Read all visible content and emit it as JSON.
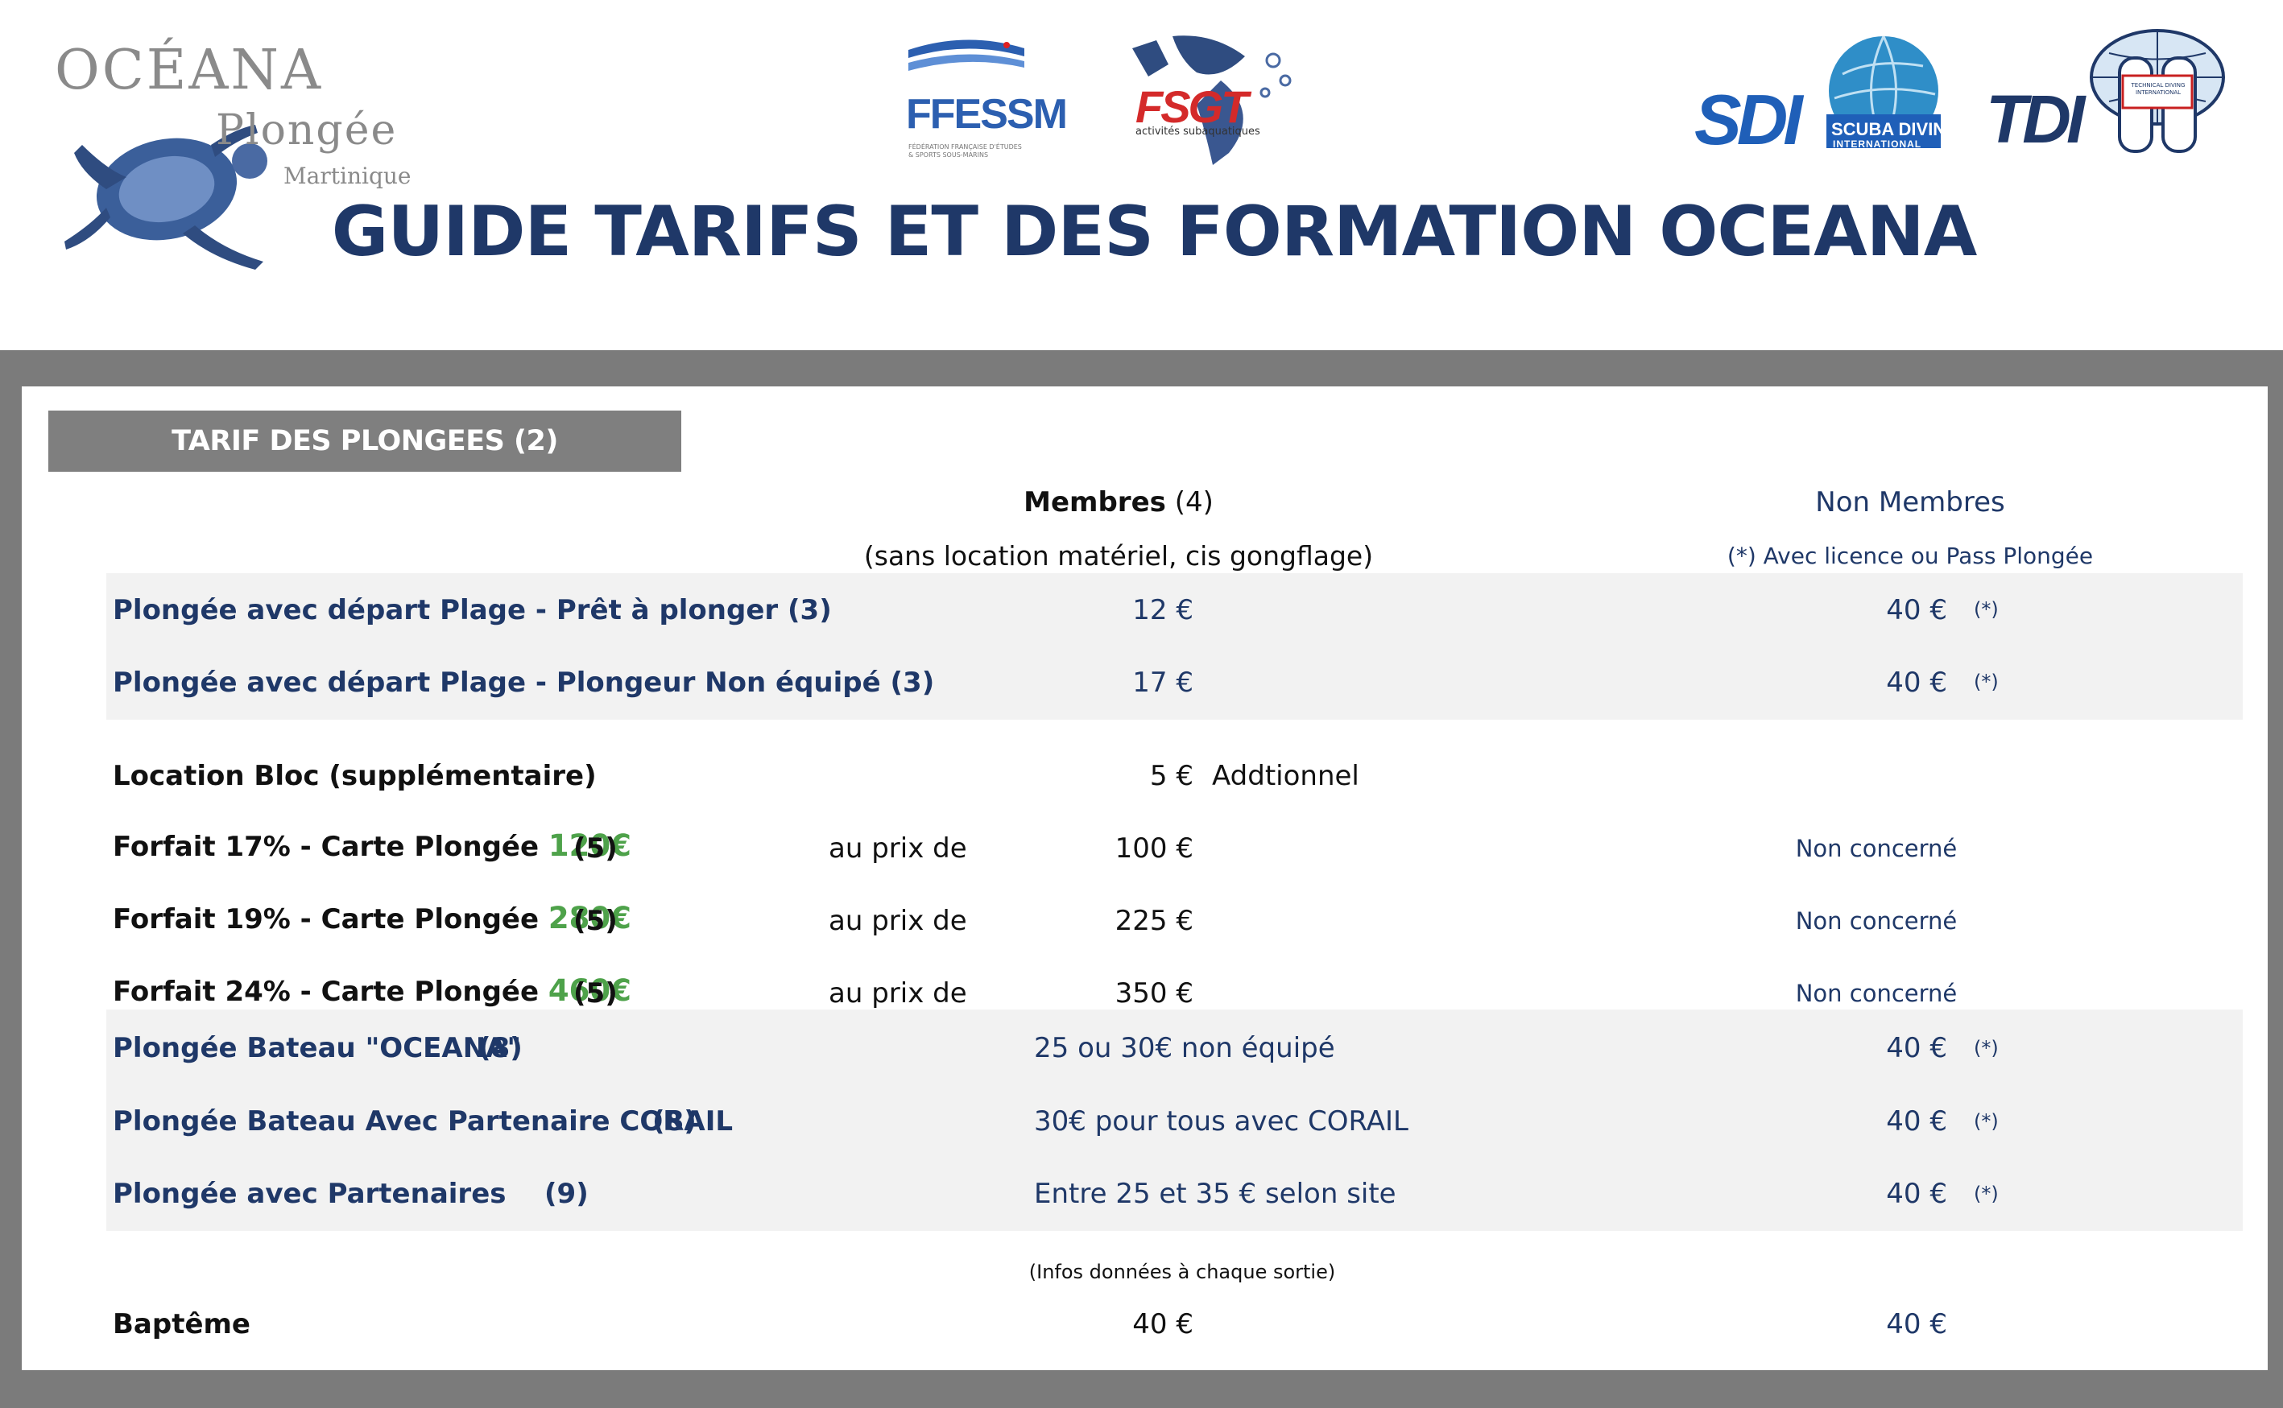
{
  "logos": {
    "oceana_line1": "OCÉANA",
    "oceana_line2": "Plongée",
    "oceana_line3": "Martinique",
    "ffessm": "FFESSM",
    "ffessm_sub": "FÉDÉRATION FRANÇAISE D'ÉTUDES & SPORTS SOUS-MARINS",
    "fsgt": "FSGT",
    "fsgt_sub": "activités subaquatiques",
    "sdi": "SDI",
    "sdi_sub1": "SCUBA DIVING",
    "sdi_sub2": "INTERNATIONAL",
    "tdi": "TDI",
    "tdi_sub": "TECHNICAL DIVING INTERNATIONAL"
  },
  "page_title": "GUIDE TARIFS ET DES FORMATION OCEANA",
  "section_title": "TARIF DES PLONGEES (2)",
  "columns": {
    "members_bold": "Membres",
    "members_note": " (4)",
    "members_sub": "(sans location matériel, cis gongflage)",
    "non_members": "Non Membres",
    "non_members_sub": "(*) Avec licence ou Pass Plongée"
  },
  "rows": {
    "r1": {
      "label": "Plongée avec départ Plage -  Prêt à plonger (3)",
      "member": "12 €",
      "non_member": "40 €",
      "star": "(*)"
    },
    "r2": {
      "label": "Plongée avec départ Plage - Plongeur Non équipé (3)",
      "member": "17 €",
      "non_member": "40 €",
      "star": "(*)"
    },
    "r3": {
      "label": "Location Bloc (supplémentaire)",
      "member": "5 €",
      "extra": "Addtionnel"
    },
    "r4": {
      "label": "Forfait 17% - Carte Plongée ",
      "price": "120€",
      "note": "(5)",
      "au_prix": "au prix de",
      "member": "100 €",
      "non_member": "Non concerné"
    },
    "r5": {
      "label": "Forfait 19% - Carte Plongée ",
      "price": "280€",
      "note": "(5)",
      "au_prix": "au prix de",
      "member": "225 €",
      "non_member": "Non concerné"
    },
    "r6": {
      "label": "Forfait 24% - Carte Plongée ",
      "price": "460€",
      "note": "(5)",
      "au_prix": "au prix de",
      "member": "350 €",
      "non_member": "Non concerné"
    },
    "r7": {
      "label": "Plongée Bateau \"OCEANA\"",
      "note": "(8)",
      "member": "25 ou 30€ non équipé",
      "non_member": "40 €",
      "star": "(*)"
    },
    "r8": {
      "label": "Plongée Bateau Avec Partenaire CORAIL",
      "note": "(8)",
      "member": "30€ pour tous avec CORAIL",
      "non_member": "40 €",
      "star": "(*)"
    },
    "r9": {
      "label": "Plongée avec Partenaires",
      "note": "(9)",
      "member": "Entre 25 et 35 € selon site",
      "non_member": "40 €",
      "star": "(*)"
    },
    "infos": "(Infos données à chaque sortie)",
    "r10": {
      "label": "Baptême",
      "member": "40 €",
      "non_member": "40 €"
    }
  },
  "colors": {
    "navy": "#1f3868",
    "green": "#4ea24a",
    "frame_gray": "#7b7b7b",
    "band_gray": "#f2f2f2"
  }
}
